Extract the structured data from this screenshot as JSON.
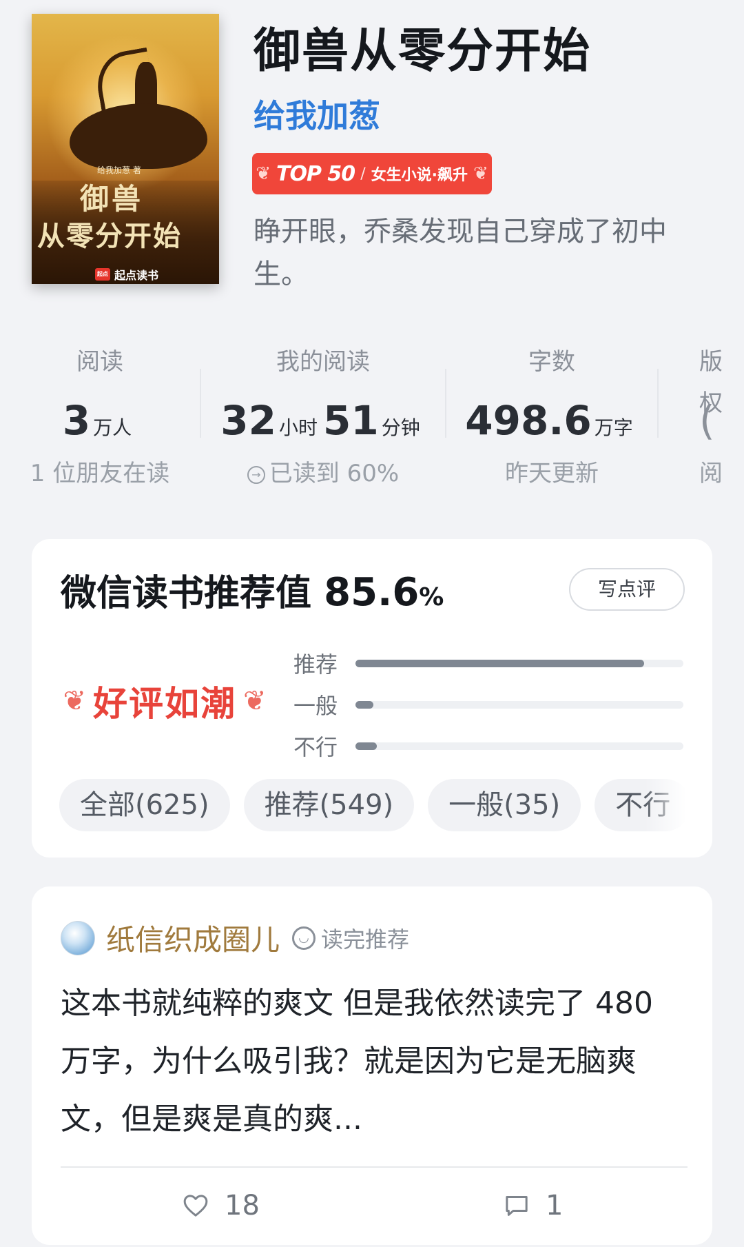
{
  "book": {
    "title": "御兽从零分开始",
    "author": "给我加葱",
    "rank_top": "TOP 50",
    "rank_sep": "/",
    "rank_category": "女生小说·飙升",
    "intro": "睁开眼，乔桑发现自己穿成了初中生。",
    "cover": {
      "author_line": "给我加葱 著",
      "title_line1": "御兽",
      "title_line2": "从零分开始",
      "publisher": "起点读书",
      "publisher_logo": "起点"
    }
  },
  "stats": [
    {
      "label": "阅读",
      "num1": "3",
      "unit1": "万人",
      "sub": "1 位朋友在读"
    },
    {
      "label": "我的阅读",
      "num1": "32",
      "unit1": "小时",
      "num2": "51",
      "unit2": "分钟",
      "sub": "已读到 60%",
      "sub_icon": "arrow-circle-icon"
    },
    {
      "label": "字数",
      "num1": "498.6",
      "unit1": "万字",
      "sub": "昨天更新"
    },
    {
      "label": "版权",
      "num1": "(",
      "sub": "阅"
    }
  ],
  "rating": {
    "title": "微信读书推荐值",
    "percent": "85.6",
    "percent_sign": "%",
    "write_review": "写点评",
    "badge": "好评如潮",
    "bars": [
      {
        "label": "推荐",
        "fraction": 0.88
      },
      {
        "label": "一般",
        "fraction": 0.055
      },
      {
        "label": "不行",
        "fraction": 0.065
      }
    ],
    "filters": [
      "全部(625)",
      "推荐(549)",
      "一般(35)",
      "不行"
    ]
  },
  "review": {
    "user": "纸信织成圈儿",
    "tag": "读完推荐",
    "text": "这本书就纯粹的爽文 但是我依然读完了 480 万字，为什么吸引我？就是因为它是无脑爽文，但是爽是真的爽...",
    "likes": "18",
    "comments": "1"
  },
  "colors": {
    "author": "#2f7bd9",
    "badge_red": "#f0463a",
    "praise_red": "#e8433a",
    "reviewer_name": "#a07a3d",
    "bar_fill": "#7f8792"
  }
}
